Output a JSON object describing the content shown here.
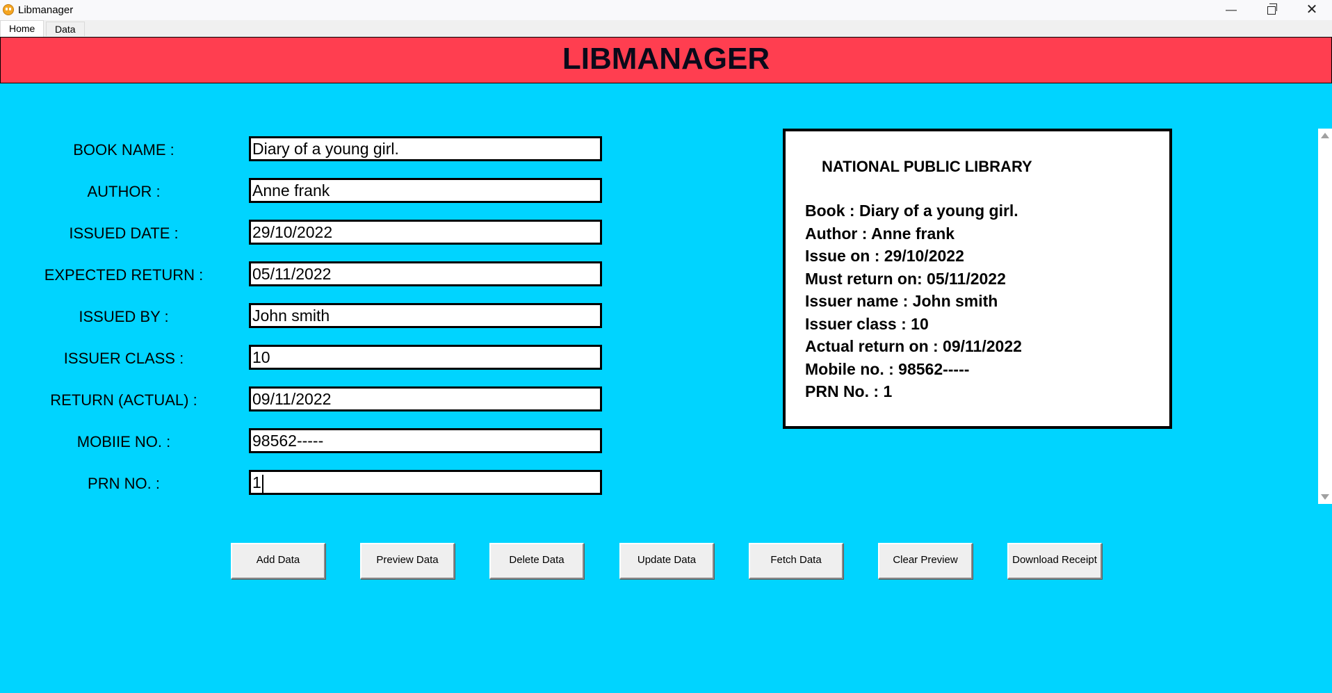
{
  "window": {
    "title": "Libmanager",
    "minimize": "—",
    "close": "✕"
  },
  "tabs": [
    {
      "label": "Home"
    },
    {
      "label": "Data"
    }
  ],
  "header": {
    "title": "LIBMANAGER"
  },
  "form": {
    "fields": [
      {
        "label": "BOOK NAME :",
        "value": "Diary of a young girl."
      },
      {
        "label": "AUTHOR :",
        "value": "Anne frank"
      },
      {
        "label": "ISSUED DATE :",
        "value": "29/10/2022"
      },
      {
        "label": "EXPECTED RETURN :",
        "value": "05/11/2022"
      },
      {
        "label": "ISSUED BY :",
        "value": "John smith"
      },
      {
        "label": "ISSUER CLASS :",
        "value": "10"
      },
      {
        "label": "RETURN (ACTUAL) :",
        "value": "09/11/2022"
      },
      {
        "label": "MOBIIE NO. :",
        "value": "98562-----"
      },
      {
        "label": "PRN NO. :",
        "value": "1"
      }
    ]
  },
  "receipt": {
    "title": "NATIONAL PUBLIC LIBRARY",
    "lines": [
      "Book : Diary of a young girl.",
      "Author : Anne frank",
      "Issue on : 29/10/2022",
      "Must return on: 05/11/2022",
      "Issuer name : John smith",
      "Issuer class : 10",
      "Actual return on : 09/11/2022",
      "Mobile no. : 98562-----",
      "PRN No. : 1"
    ]
  },
  "buttons": [
    {
      "label": "Add Data"
    },
    {
      "label": "Preview Data"
    },
    {
      "label": "Delete Data"
    },
    {
      "label": "Update Data"
    },
    {
      "label": "Fetch Data"
    },
    {
      "label": "Clear Preview"
    },
    {
      "label": "Download Receipt"
    }
  ],
  "colors": {
    "background": "#00d4ff",
    "header": "#ff3e50",
    "header_text": "#0a0a1a"
  },
  "icons": {
    "app": "app-icon",
    "minimize": "minimize-icon",
    "maximize": "maximize-icon",
    "close": "close-icon"
  }
}
